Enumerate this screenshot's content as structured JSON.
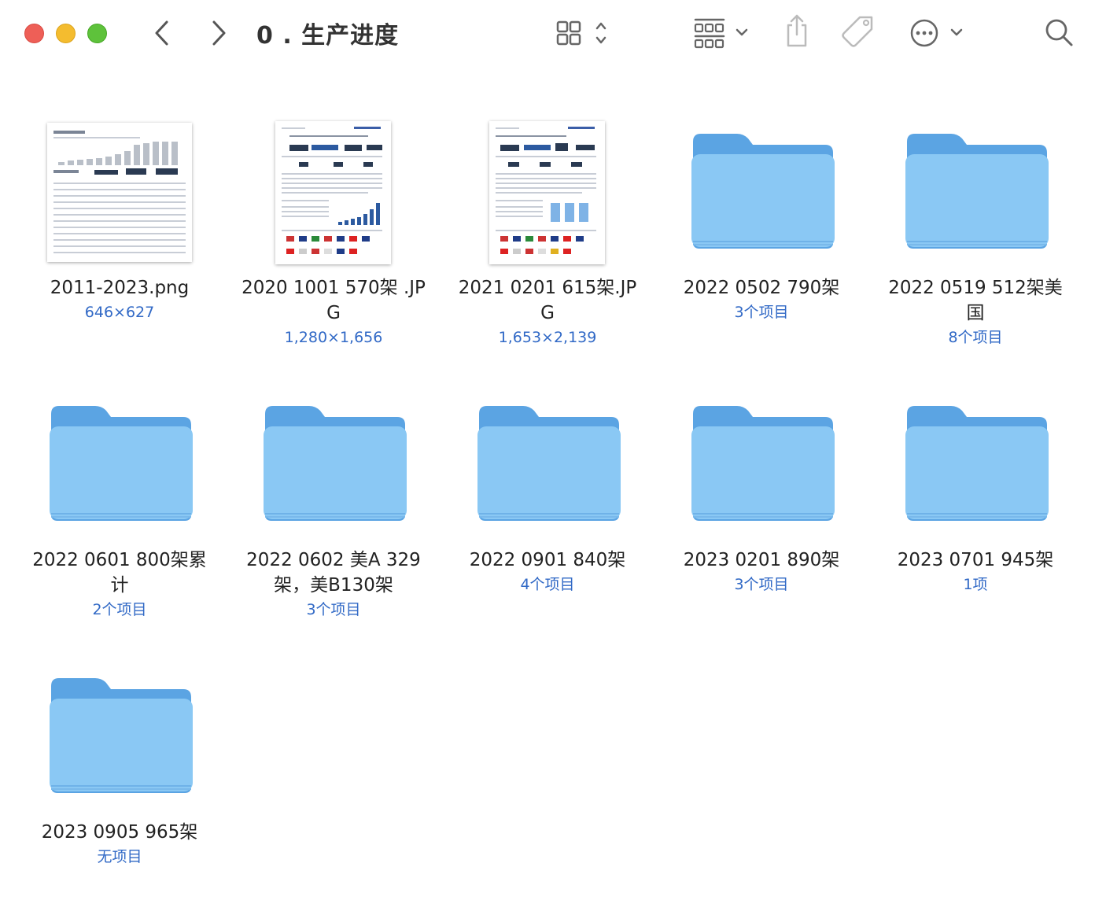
{
  "window": {
    "title": "0 . 生产进度"
  },
  "toolbar": {
    "back_icon": "chevron-left-icon",
    "forward_icon": "chevron-right-icon",
    "view_icon": "grid-view-icon",
    "group_icon": "group-by-icon",
    "share_icon": "share-icon",
    "tag_icon": "tag-icon",
    "more_icon": "ellipsis-circle-icon",
    "search_icon": "search-icon"
  },
  "colors": {
    "close": "#ee5f57",
    "minimize": "#f4bc2f",
    "zoom": "#5ec23b",
    "folder_front": "#8ac8f4",
    "folder_back": "#5ba4e3",
    "subtitle": "#3169c6"
  },
  "items": [
    {
      "name": "2011-2023.png",
      "sub": "646×627",
      "kind": "image"
    },
    {
      "name": "2020 1001 570架 .JPG",
      "sub": "1,280×1,656",
      "kind": "image"
    },
    {
      "name": "2021 0201  615架.JPG",
      "sub": "1,653×2,139",
      "kind": "image"
    },
    {
      "name": "2022 0502 790架",
      "sub": "3个项目",
      "kind": "folder"
    },
    {
      "name": "2022 0519 512架美国",
      "sub": "8个项目",
      "kind": "folder"
    },
    {
      "name": "2022 0601 800架累计",
      "sub": "2个项目",
      "kind": "folder"
    },
    {
      "name": "2022 0602 美A 329架，美B130架",
      "sub": "3个项目",
      "kind": "folder"
    },
    {
      "name": "2022 0901 840架",
      "sub": "4个项目",
      "kind": "folder"
    },
    {
      "name": "2023 0201  890架",
      "sub": "3个项目",
      "kind": "folder"
    },
    {
      "name": "2023 0701 945架",
      "sub": "1项",
      "kind": "folder"
    },
    {
      "name": "2023 0905 965架",
      "sub": "无项目",
      "kind": "folder"
    }
  ]
}
